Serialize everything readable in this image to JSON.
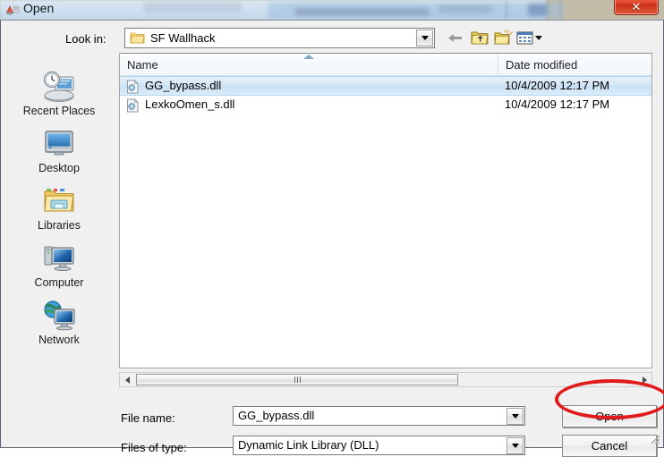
{
  "window": {
    "title": "Open",
    "title_icon": "app-icon",
    "close_button_label": "✕"
  },
  "toolbar": {
    "lookin_label": "Look in:",
    "lookin_value": "SF Wallhack",
    "lookin_folder_icon": "folder-icon",
    "buttons": [
      {
        "name": "back-button",
        "icon": "back-arrow-icon",
        "label": "Back"
      },
      {
        "name": "up-one-level-button",
        "icon": "up-folder-icon",
        "label": "Up One Level"
      },
      {
        "name": "new-folder-button",
        "icon": "new-folder-icon",
        "label": "Create New Folder"
      },
      {
        "name": "views-button",
        "icon": "views-icon",
        "label": "Views"
      }
    ]
  },
  "places": {
    "items": [
      {
        "label": "Recent Places",
        "icon": "recent-places-icon"
      },
      {
        "label": "Desktop",
        "icon": "desktop-icon"
      },
      {
        "label": "Libraries",
        "icon": "libraries-icon"
      },
      {
        "label": "Computer",
        "icon": "computer-icon"
      },
      {
        "label": "Network",
        "icon": "network-icon"
      }
    ]
  },
  "file_list": {
    "columns": [
      {
        "label": "Name"
      },
      {
        "label": "Date modified"
      }
    ],
    "sort_column": "Name",
    "sort_direction": "ascending",
    "rows": [
      {
        "name": "GG_bypass.dll",
        "date_modified": "10/4/2009 12:17 PM",
        "icon": "dll-file-icon",
        "selected": true
      },
      {
        "name": "LexkoOmen_s.dll",
        "date_modified": "10/4/2009 12:17 PM",
        "icon": "dll-file-icon",
        "selected": false
      }
    ]
  },
  "form": {
    "filename_label": "File name:",
    "filename_value": "GG_bypass.dll",
    "filetype_label": "Files of type:",
    "filetype_value": "Dynamic Link Library (DLL)"
  },
  "actions": {
    "open_label": "Open",
    "cancel_label": "Cancel"
  },
  "annotation": {
    "shape": "ellipse",
    "color": "#e01b1b",
    "targets": "open-button"
  },
  "colors": {
    "dialog_background": "#f0f0f0",
    "selection_blue": "#c8e0f3",
    "close_red": "#e2452a",
    "annotation_red": "#e01b1b",
    "desktop_tan": "#bdb6a2"
  }
}
